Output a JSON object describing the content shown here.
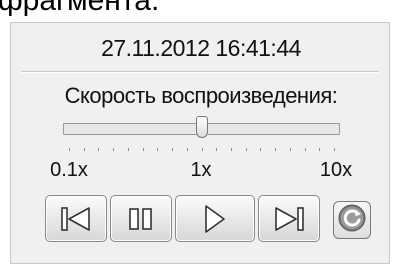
{
  "caption_fragment": "фрагмента.",
  "player": {
    "timestamp": "27.11.2012 16:41:44",
    "speed_label": "Скорость воспроизведения:",
    "speed_value": "1x",
    "scale": {
      "min": "0.1x",
      "mid": "1x",
      "max": "10x"
    }
  },
  "controls": [
    {
      "name": "skip-to-start",
      "icon": "skip-start-icon"
    },
    {
      "name": "pause",
      "icon": "pause-icon"
    },
    {
      "name": "play",
      "icon": "play-icon"
    },
    {
      "name": "skip-to-end",
      "icon": "skip-end-icon"
    },
    {
      "name": "refresh",
      "icon": "refresh-icon"
    }
  ],
  "colors": {
    "panel_bg": "#f0f0f0",
    "refresh_blue": "#2f5a9c"
  }
}
